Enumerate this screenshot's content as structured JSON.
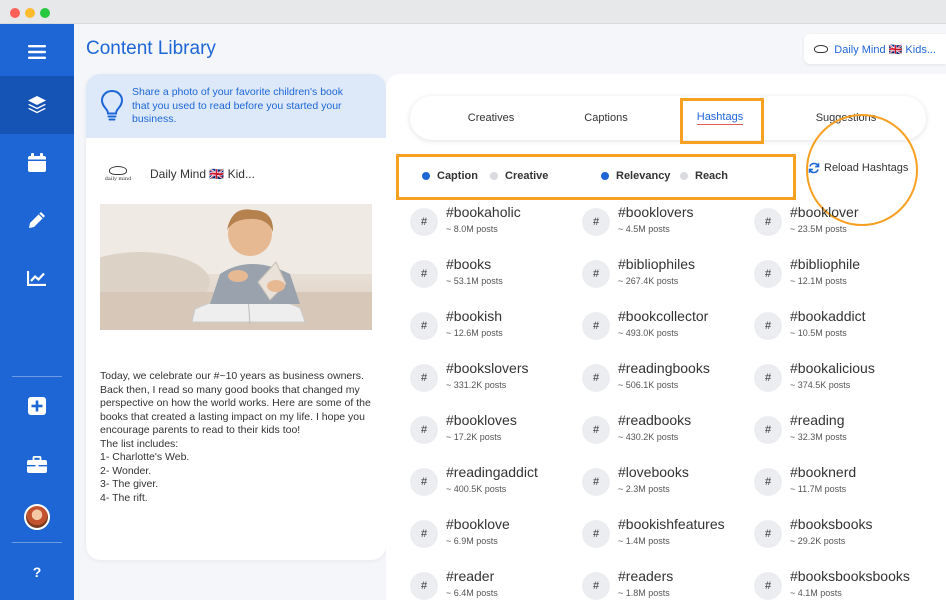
{
  "window": {
    "controls": [
      "close",
      "minimize",
      "maximize"
    ]
  },
  "sidebar": {
    "items": [
      {
        "name": "menu",
        "icon": "hamburger-menu-icon"
      },
      {
        "name": "content-library",
        "icon": "layers-icon",
        "active": true
      },
      {
        "name": "calendar",
        "icon": "calendar-icon"
      },
      {
        "name": "edit",
        "icon": "pencil-icon"
      },
      {
        "name": "analytics",
        "icon": "chart-line-icon"
      },
      {
        "name": "add",
        "icon": "plus-square-icon"
      },
      {
        "name": "briefcase",
        "icon": "briefcase-icon"
      },
      {
        "name": "profile",
        "icon": "avatar"
      },
      {
        "name": "help",
        "label": "?"
      }
    ]
  },
  "header": {
    "title": "Content Library",
    "account_label": "Daily Mind 🇬🇧 Kids..."
  },
  "left_card": {
    "idea_text": "Share a photo of your favorite children's book that you used to read before you started your business.",
    "brand_logo_text": "daily mind",
    "brand_name": "Daily Mind 🇬🇧 Kid...",
    "post_text": "Today, we celebrate our #~10 years as business owners. Back then, I read so many good books that changed my perspective on how the world works. Here are some of the books that created a lasting impact on my life. I hope you encourage parents to read to their kids too!\nThe list includes:\n1- Charlotte's Web.\n2- Wonder.\n3- The giver.\n4- The rift."
  },
  "tabs": [
    {
      "label": "Creatives",
      "active": false
    },
    {
      "label": "Captions",
      "active": false
    },
    {
      "label": "Hashtags",
      "active": true
    },
    {
      "label": "Suggestions",
      "active": false
    }
  ],
  "filters": [
    {
      "label": "Caption",
      "selected": true
    },
    {
      "label": "Creative",
      "selected": false
    },
    {
      "label": "Relevancy",
      "selected": true
    },
    {
      "label": "Reach",
      "selected": false
    }
  ],
  "reload_label": "Reload Hashtags",
  "hash_symbol": "#",
  "hashtags": [
    {
      "tag": "#bookaholic",
      "posts": "~ 8.0M posts"
    },
    {
      "tag": "#booklovers",
      "posts": "~ 4.5M posts"
    },
    {
      "tag": "#booklover",
      "posts": "~ 23.5M posts"
    },
    {
      "tag": "#books",
      "posts": "~ 53.1M posts"
    },
    {
      "tag": "#bibliophiles",
      "posts": "~ 267.4K posts"
    },
    {
      "tag": "#bibliophile",
      "posts": "~ 12.1M posts"
    },
    {
      "tag": "#bookish",
      "posts": "~ 12.6M posts"
    },
    {
      "tag": "#bookcollector",
      "posts": "~ 493.0K posts"
    },
    {
      "tag": "#bookaddict",
      "posts": "~ 10.5M posts"
    },
    {
      "tag": "#bookslovers",
      "posts": "~ 331.2K posts"
    },
    {
      "tag": "#readingbooks",
      "posts": "~ 506.1K posts"
    },
    {
      "tag": "#bookalicious",
      "posts": "~ 374.5K posts"
    },
    {
      "tag": "#bookloves",
      "posts": "~ 17.2K posts"
    },
    {
      "tag": "#readbooks",
      "posts": "~ 430.2K posts"
    },
    {
      "tag": "#reading",
      "posts": "~ 32.3M posts"
    },
    {
      "tag": "#readingaddict",
      "posts": "~ 400.5K posts"
    },
    {
      "tag": "#lovebooks",
      "posts": "~ 2.3M posts"
    },
    {
      "tag": "#booknerd",
      "posts": "~ 11.7M posts"
    },
    {
      "tag": "#booklove",
      "posts": "~ 6.9M posts"
    },
    {
      "tag": "#bookishfeatures",
      "posts": "~ 1.4M posts"
    },
    {
      "tag": "#booksbooks",
      "posts": "~ 29.2K posts"
    },
    {
      "tag": "#reader",
      "posts": "~ 6.4M posts"
    },
    {
      "tag": "#readers",
      "posts": "~ 1.8M posts"
    },
    {
      "tag": "#booksbooksbooks",
      "posts": "~ 4.1M posts"
    }
  ],
  "colors": {
    "accent": "#1e66d6",
    "sidebar": "#1e66d6",
    "highlight": "#f7a021"
  }
}
